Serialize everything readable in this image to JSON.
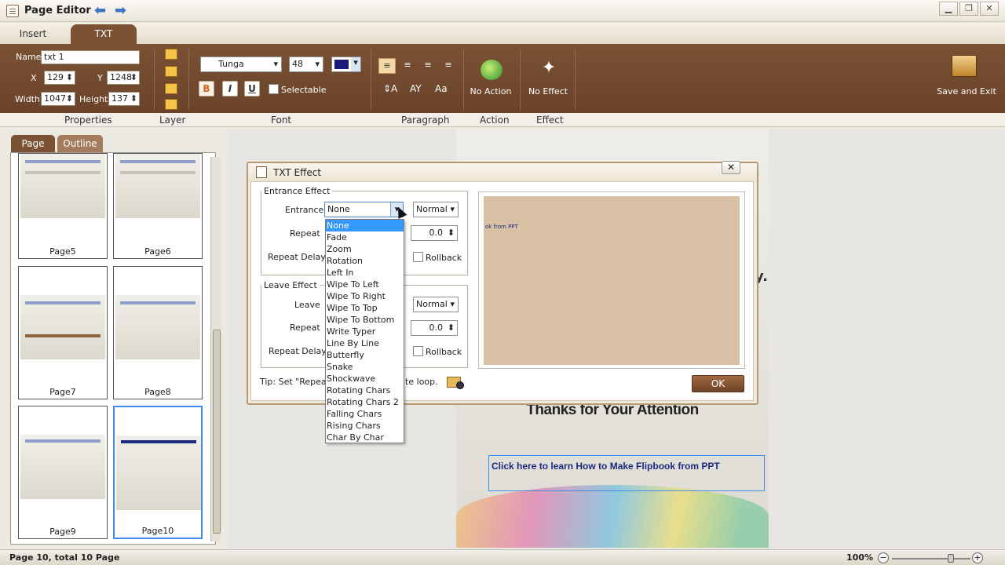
{
  "window": {
    "title": "Page Editor"
  },
  "tabs": {
    "insert": "Insert",
    "txt": "TXT"
  },
  "properties": {
    "name_label": "Name",
    "name_value": "txt 1",
    "x_label": "X",
    "x_value": "129",
    "y_label": "Y",
    "y_value": "1248",
    "width_label": "Width",
    "width_value": "1047",
    "height_label": "Height",
    "height_value": "137"
  },
  "font": {
    "family": "Tunga",
    "size": "48",
    "bold": "B",
    "italic": "I",
    "underline": "U",
    "selectable": "Selectable",
    "color": "#1a1a7a"
  },
  "actions": {
    "no_action": "No Action",
    "no_effect": "No Effect",
    "save_exit": "Save and Exit"
  },
  "ribbon_groups": [
    "Properties",
    "Layer",
    "Font",
    "Paragraph",
    "Action",
    "Effect"
  ],
  "left_panel": {
    "tabs": [
      "Page",
      "Outline"
    ],
    "pages": [
      {
        "label": "Page5"
      },
      {
        "label": "Page6"
      },
      {
        "label": "Page7"
      },
      {
        "label": "Page8"
      },
      {
        "label": "Page9"
      },
      {
        "label": "Page10"
      }
    ]
  },
  "canvas": {
    "thanks_text": "Thanks for Your Attention",
    "link_text": "Click here to learn How to Make Flipbook from PPT",
    "stray_char": "y."
  },
  "dialog": {
    "title": "TXT Effect",
    "entrance_group": "Entrance Effect",
    "entrance_label": "Entrance",
    "entrance_value": "None",
    "entrance_speed": "Normal",
    "repeat_label": "Repeat",
    "repeat_value": "0.0",
    "repeat_delay_label": "Repeat Delay",
    "rollback": "Rollback",
    "leave_group": "Leave Effect",
    "leave_label": "Leave",
    "leave_speed": "Normal",
    "leave_repeat_label": "Repeat",
    "leave_repeat_value": "0.0",
    "leave_repeat_delay_label": "Repeat Delay",
    "leave_rollback": "Rollback",
    "tip_start": "Tip: Set \"Repeat\"",
    "tip_end": "ite loop.",
    "ok": "OK",
    "preview_text": "ok from PPT",
    "effects": [
      "None",
      "Fade",
      "Zoom",
      "Rotation",
      "Left In",
      "Wipe To Left",
      "Wipe To Right",
      "Wipe To Top",
      "Wipe To Bottom",
      "Write Typer",
      "Line By Line",
      "Butterfly",
      "Snake",
      "Shockwave",
      "Rotating Chars",
      "Rotating Chars 2",
      "Falling Chars",
      "Rising Chars",
      "Char By Char"
    ]
  },
  "status": {
    "text": "Page 10, total 10 Page",
    "zoom": "100%"
  }
}
